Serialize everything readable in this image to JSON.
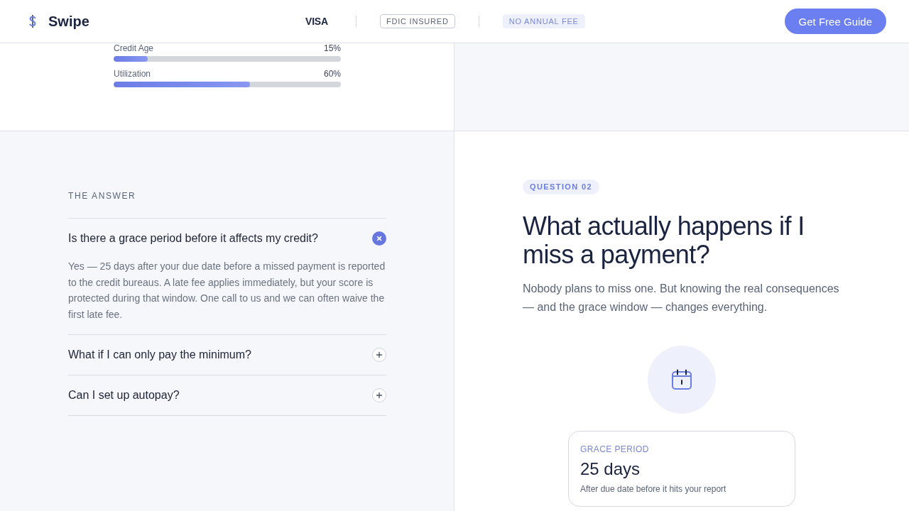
{
  "header": {
    "logo": {
      "name": "Swipe"
    },
    "trust_badges": [
      {
        "kind": "brand",
        "label": "VISA"
      },
      {
        "kind": "outline",
        "label": "FDIC INSURED"
      },
      {
        "kind": "tint",
        "label": "NO ANNUAL FEE"
      }
    ],
    "cta": "Get Free Guide"
  },
  "score_factors": [
    {
      "label": "Credit Age",
      "value": "15%",
      "level": 0.15
    },
    {
      "label": "Utilization",
      "value": "60%",
      "level": 0.6
    }
  ],
  "answer_panel": {
    "eyebrow": "THE ANSWER",
    "faq": [
      {
        "question": "Is there a grace period before it affects my credit?",
        "expanded": true,
        "answer": "Yes — 25 days after your due date before a missed payment is reported to the credit bureaus. A late fee applies immediately, but your score is protected during that window. One call to us and we can often waive the first late fee."
      },
      {
        "question": "What if I can only pay the minimum?",
        "expanded": false
      },
      {
        "question": "Can I set up autopay?",
        "expanded": false
      }
    ]
  },
  "question_panel": {
    "tag": "QUESTION 02",
    "heading": "What actually happens if I miss a payment?",
    "lead": "Nobody plans to miss one. But knowing the real consequences — and the grace window — changes everything.",
    "stat_card": {
      "label": "GRACE PERIOD",
      "value": "25 days",
      "note": "After due date before it hits your report"
    }
  }
}
